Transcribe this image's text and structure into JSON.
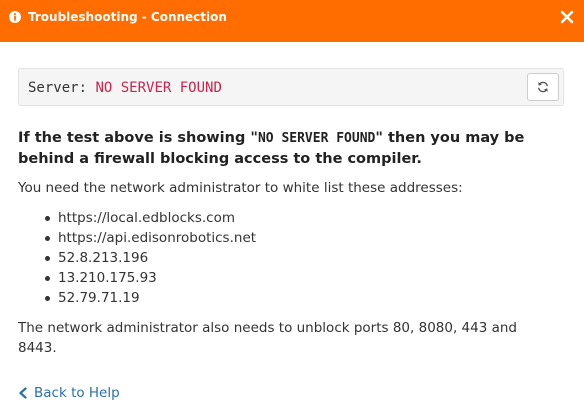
{
  "header": {
    "title": "Troubleshooting - Connection",
    "info_icon": "info-circle-icon",
    "close_icon": "close-icon",
    "background_color": "#ff6d00"
  },
  "server": {
    "label": "Server: ",
    "status": "NO SERVER FOUND",
    "status_color": "#c7254e",
    "refresh_icon": "refresh-icon"
  },
  "warning": {
    "part1": "If the test above is showing \"",
    "code": "NO SERVER FOUND",
    "part2": "\" then you may be behind a firewall blocking access to the compiler."
  },
  "instructions": {
    "need_text": "You need the network administrator to white list these addresses:",
    "addresses": [
      "https://local.edblocks.com",
      "https://api.edisonrobotics.net",
      "52.8.213.196",
      "13.210.175.93",
      "52.79.71.19"
    ],
    "ports_text": "The network administrator also needs to unblock ports 80, 8080, 443 and 8443."
  },
  "footer": {
    "back_label": "Back to Help",
    "back_icon": "chevron-left-icon",
    "link_color": "#2a6fb0"
  }
}
